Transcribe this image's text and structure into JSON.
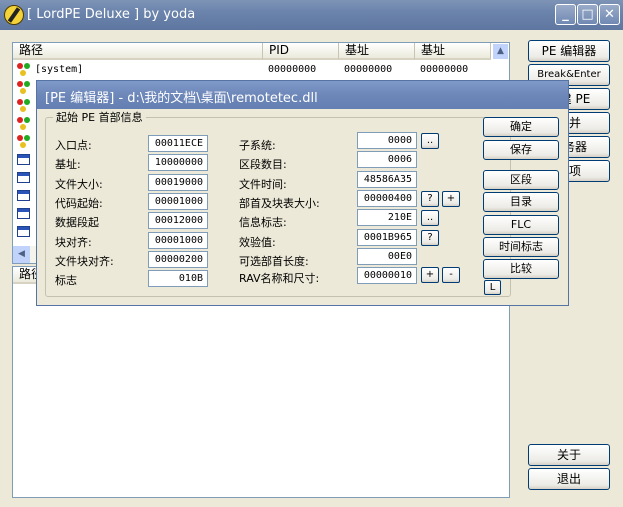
{
  "window": {
    "title": "[ LordPE Deluxe ] by yoda",
    "min": "_",
    "max": "□",
    "close": "✕"
  },
  "process_list": {
    "columns": [
      "路径",
      "PID",
      "基址",
      "基址"
    ],
    "rows": [
      {
        "path": "[system]",
        "pid": "00000000",
        "base": "00000000",
        "base2": "00000000",
        "icon": "process-icon"
      }
    ],
    "icon_rows": [
      "process-icon",
      "process-icon",
      "process-icon",
      "process-icon",
      "window-icon",
      "window-icon",
      "window-icon",
      "window-icon",
      "window-icon"
    ]
  },
  "module_list": {
    "columns": [
      "路径"
    ]
  },
  "right_buttons": {
    "pe_editor": "PE 编辑器",
    "break_enter": "Break&Enter",
    "rebuild_pe": "重建 PE",
    "merge": "合并",
    "services": "服务器",
    "options": "选项",
    "about": "关于",
    "exit": "退出"
  },
  "pe_editor": {
    "title": "[PE 编辑器] - d:\\我的文档\\桌面\\remotetec.dll",
    "group_label": "起始 PE 首部信息",
    "left_fields": [
      {
        "label": "入口点:",
        "value": "00011ECE"
      },
      {
        "label": "基址:",
        "value": "10000000"
      },
      {
        "label": "文件大小:",
        "value": "00019000"
      },
      {
        "label": "代码起始:",
        "value": "00001000"
      },
      {
        "label": "数据段起",
        "value": "00012000"
      },
      {
        "label": "块对齐:",
        "value": "00001000"
      },
      {
        "label": "文件块对齐:",
        "value": "00000200"
      },
      {
        "label": "标志",
        "value": "010B"
      }
    ],
    "right_fields": [
      {
        "label": "子系统:",
        "value": "0000"
      },
      {
        "label": "区段数目:",
        "value": "0006"
      },
      {
        "label": "文件时间:",
        "value": "48586A35"
      },
      {
        "label": "部首及块表大小:",
        "value": "00000400"
      },
      {
        "label": "信息标志:",
        "value": "210E"
      },
      {
        "label": "效验值:",
        "value": "0001B965"
      },
      {
        "label": "可选部首长度:",
        "value": "00E0"
      },
      {
        "label": "RAV名称和尺寸:",
        "value": "00000010"
      }
    ],
    "small_buttons": {
      "dots": "..",
      "question": "?",
      "plus": "+",
      "minus": "-"
    },
    "buttons": {
      "ok": "确定",
      "save": "保存",
      "sections": "区段",
      "directories": "目录",
      "flc": "FLC",
      "timestamp": "时间标志",
      "compare": "比较",
      "l": "L"
    }
  }
}
